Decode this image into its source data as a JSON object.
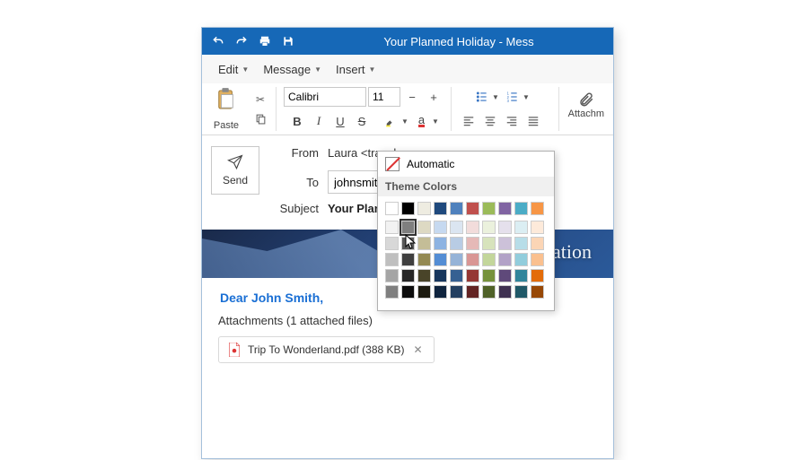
{
  "titlebar": {
    "title": "Your Planned Holiday - Mess"
  },
  "menubar": {
    "edit": "Edit",
    "message": "Message",
    "insert": "Insert"
  },
  "ribbon": {
    "paste": "Paste",
    "font_name": "Calibri",
    "font_size": "11",
    "bold": "B",
    "italic": "I",
    "underline": "U",
    "strike": "S",
    "attachments": "Attachm"
  },
  "compose": {
    "send": "Send",
    "from_label": "From",
    "from_value": "Laura <travela",
    "to_label": "To",
    "to_value": "johnsmith@a",
    "subject_label": "Subject",
    "subject_value": "Your Planned"
  },
  "banner": {
    "text": "Dream Vacation"
  },
  "body": {
    "greeting": "Dear John Smith,"
  },
  "attachments": {
    "header": "Attachments (1 attached files)",
    "file": "Trip To Wonderland.pdf (388 KB)"
  },
  "picker": {
    "automatic": "Automatic",
    "theme_header": "Theme Colors",
    "rows": [
      [
        "#ffffff",
        "#000000",
        "#eeece1",
        "#1f497d",
        "#4f81bd",
        "#c0504d",
        "#9bbb59",
        "#8064a2",
        "#4bacc6",
        "#f79646"
      ],
      [
        "#f2f2f2",
        "#7f7f7f",
        "#ddd9c3",
        "#c6d9f0",
        "#dbe5f1",
        "#f2dcdb",
        "#ebf1dd",
        "#e5e0ec",
        "#dbeef3",
        "#fdeada"
      ],
      [
        "#d8d8d8",
        "#595959",
        "#c4bd97",
        "#8db3e2",
        "#b8cce4",
        "#e5b9b7",
        "#d7e3bc",
        "#ccc1d9",
        "#b7dde8",
        "#fbd5b5"
      ],
      [
        "#bfbfbf",
        "#3f3f3f",
        "#938953",
        "#548dd4",
        "#95b3d7",
        "#d99694",
        "#c3d69b",
        "#b2a2c7",
        "#92cddc",
        "#fac08f"
      ],
      [
        "#a5a5a5",
        "#262626",
        "#494429",
        "#17365d",
        "#366092",
        "#953734",
        "#76923c",
        "#5f497a",
        "#31859b",
        "#e36c09"
      ],
      [
        "#7f7f7f",
        "#0c0c0c",
        "#1d1b10",
        "#0f243e",
        "#244061",
        "#632423",
        "#4f6128",
        "#3f3151",
        "#205867",
        "#974806"
      ]
    ],
    "selected": [
      1,
      1
    ]
  }
}
